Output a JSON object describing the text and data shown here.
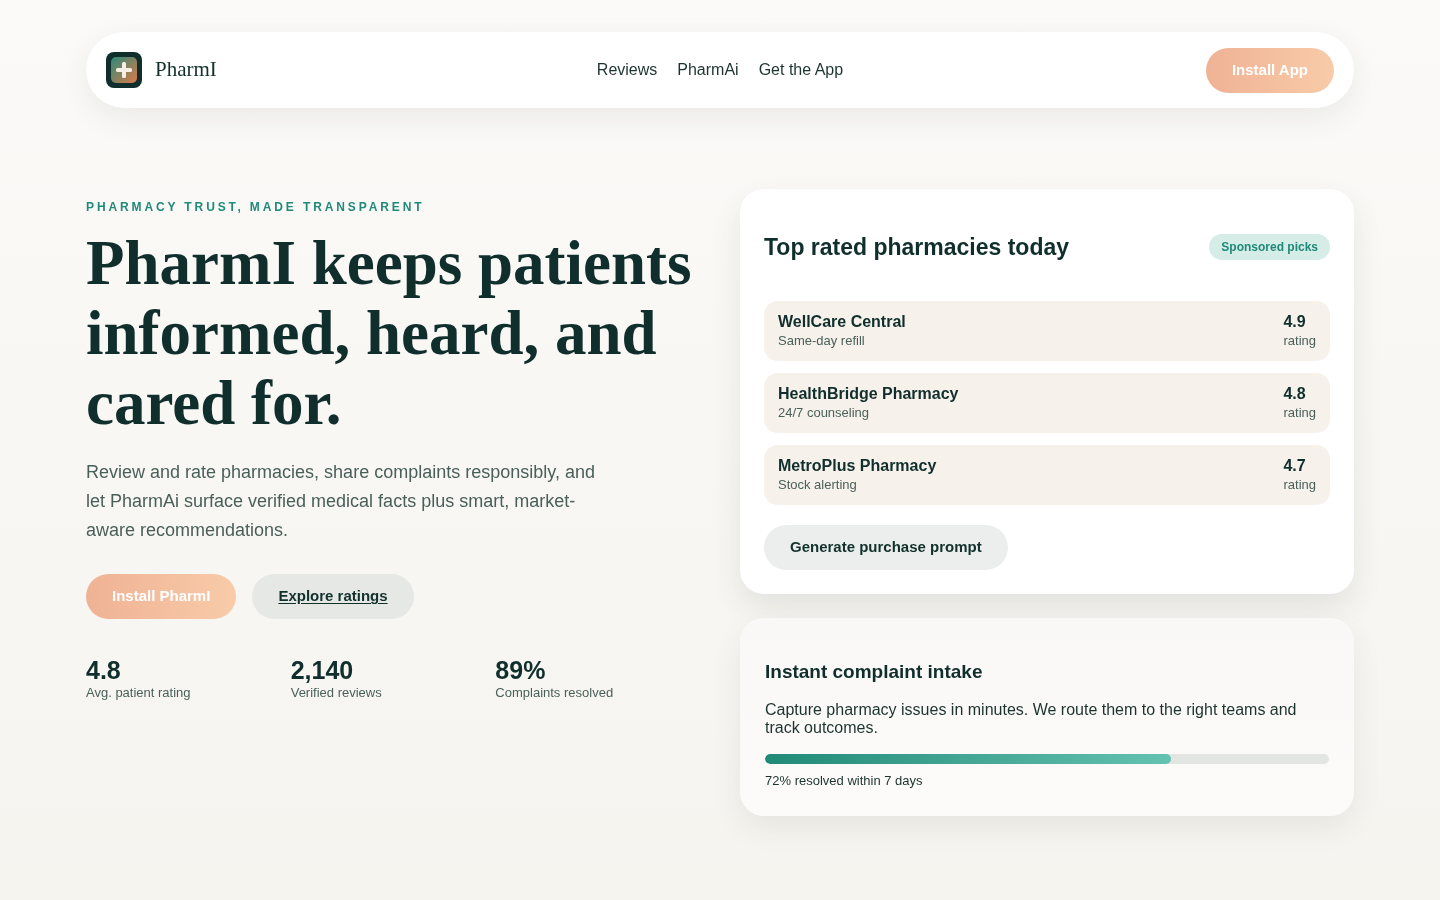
{
  "nav": {
    "brand": "PharmI",
    "links": [
      "Reviews",
      "PharmAi",
      "Get the App"
    ],
    "cta": "Install App"
  },
  "hero": {
    "eyebrow": "PHARMACY TRUST, MADE TRANSPARENT",
    "headline": "PharmI keeps patients informed, heard, and cared for.",
    "description": "Review and rate pharmacies, share complaints responsibly, and let PharmAi surface verified medical facts plus smart, market-aware recommendations.",
    "buttons": [
      {
        "label": "Install PharmI",
        "kind": "primary"
      },
      {
        "label": "Explore ratings",
        "kind": "secondary"
      }
    ],
    "stats": [
      {
        "value": "4.8",
        "label": "Avg. patient rating"
      },
      {
        "value": "2,140",
        "label": "Verified reviews"
      },
      {
        "value": "89%",
        "label": "Complaints resolved"
      }
    ]
  },
  "top_rated": {
    "title": "Top rated pharmacies today",
    "badge": "Sponsored picks",
    "pharmacies": [
      {
        "name": "WellCare Central",
        "feature": "Same-day refill",
        "rating": "4.9",
        "rating_label": "rating"
      },
      {
        "name": "HealthBridge Pharmacy",
        "feature": "24/7 counseling",
        "rating": "4.8",
        "rating_label": "rating"
      },
      {
        "name": "MetroPlus Pharmacy",
        "feature": "Stock alerting",
        "rating": "4.7",
        "rating_label": "rating"
      }
    ],
    "button": "Generate purchase prompt"
  },
  "complaints": {
    "title": "Instant complaint intake",
    "description": "Capture pharmacy issues in minutes. We route them to the right teams and track outcomes.",
    "progress": {
      "level": 0.72
    },
    "caption": "72% resolved within 7 days"
  }
}
